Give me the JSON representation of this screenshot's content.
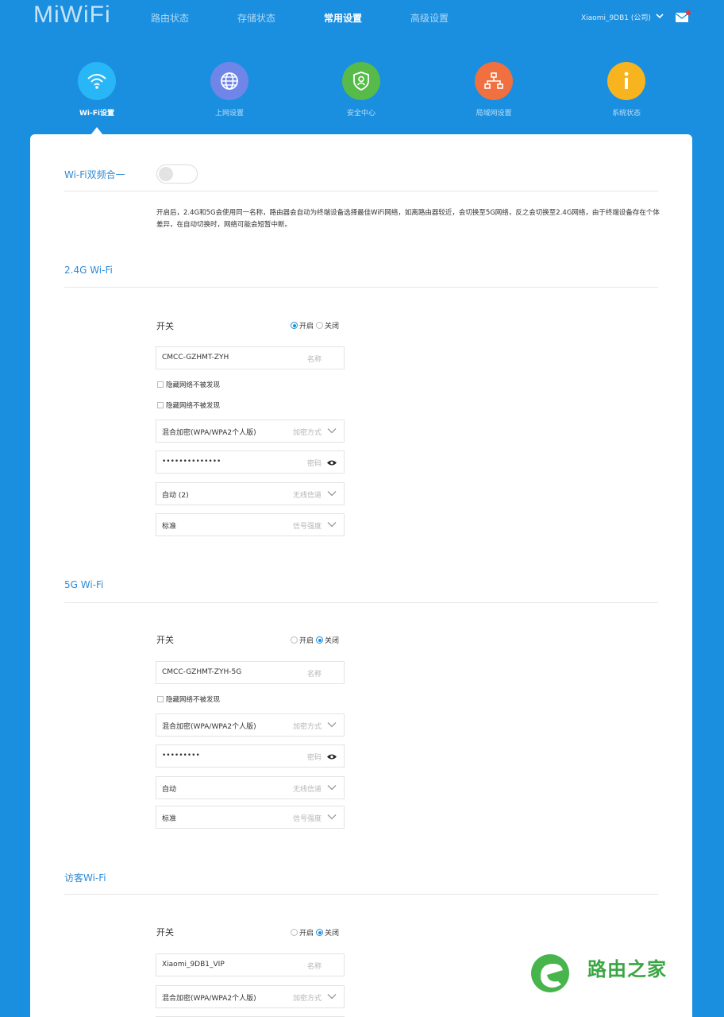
{
  "header": {
    "logo": "MiWiFi",
    "nav": [
      "路由状态",
      "存储状态",
      "常用设置",
      "高级设置"
    ],
    "active_nav": "常用设置",
    "user": "Xiaomi_9DB1 (公司)"
  },
  "categories": [
    {
      "label": "Wi-Fi设置",
      "icon": "wifi-icon",
      "color": "#29b6f6",
      "active": true
    },
    {
      "label": "上网设置",
      "icon": "globe-icon",
      "color": "#6f86e8"
    },
    {
      "label": "安全中心",
      "icon": "shield-user-icon",
      "color": "#56bb48"
    },
    {
      "label": "局域网设置",
      "icon": "network-tree-icon",
      "color": "#f0703f"
    },
    {
      "label": "系统状态",
      "icon": "info-icon",
      "color": "#f8b41e"
    }
  ],
  "dual_band": {
    "title": "Wi-Fi双频合一",
    "enabled": false,
    "description": "开启后，2.4G和5G会使用同一名称，路由器会自动为终端设备选择最佳WiFi网络，如离路由器较近，会切换至5G网络，反之会切换至2.4G网络，由于终端设备存在个体差异，在自动切换时，网络可能会短暂中断。"
  },
  "wifi_24": {
    "title": "2.4G Wi-Fi",
    "switch_label": "开关",
    "on_label": "开启",
    "off_label": "关闭",
    "state": "on",
    "ssid": "CMCC-GZHMT-ZYH",
    "ssid_placeholder": "名称",
    "hide_label": "隐藏网络不被发现",
    "hide_label_2": "隐藏网络不被发现",
    "encryption": "混合加密(WPA/WPA2个人版)",
    "encryption_placeholder": "加密方式",
    "password": "••••••••••••••",
    "password_placeholder": "密码",
    "channel": "自动 (2)",
    "channel_placeholder": "无线信道",
    "strength": "标准",
    "strength_placeholder": "信号强度"
  },
  "wifi_5": {
    "title": "5G Wi-Fi",
    "switch_label": "开关",
    "on_label": "开启",
    "off_label": "关闭",
    "state": "off",
    "ssid": "CMCC-GZHMT-ZYH-5G",
    "ssid_placeholder": "名称",
    "hide_label": "隐藏网络不被发现",
    "encryption": "混合加密(WPA/WPA2个人版)",
    "encryption_placeholder": "加密方式",
    "password": "•••••••••",
    "password_placeholder": "密码",
    "channel": "自动",
    "channel_placeholder": "无线信道",
    "strength": "标准",
    "strength_placeholder": "信号强度"
  },
  "guest": {
    "title": "访客Wi-Fi",
    "switch_label": "开关",
    "on_label": "开启",
    "off_label": "关闭",
    "state": "off",
    "ssid": "Xiaomi_9DB1_VIP",
    "ssid_placeholder": "名称",
    "encryption": "混合加密(WPA/WPA2个人版)",
    "encryption_placeholder": "加密方式"
  },
  "watermark": "路由之家"
}
